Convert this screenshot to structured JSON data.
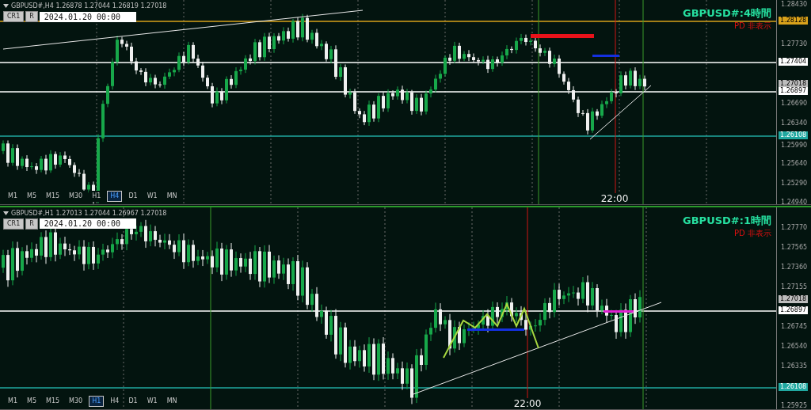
{
  "panels": [
    {
      "symbol_line": "GBPUSD#,H4  1.26878 1.27044 1.26819 1.27018",
      "buttons": [
        "CR1",
        "R"
      ],
      "date_field": "2024.01.20 00:00",
      "title": "GBPUSD#:4時間",
      "status": "PD 非表示",
      "axis_ticks": [
        "1.28430",
        "1.27730",
        "1.26690",
        "1.26340",
        "1.25990",
        "1.25640",
        "1.25290",
        "1.24940"
      ],
      "price_labels": [
        {
          "text": "1.28128",
          "color": "#d9a21b",
          "line": true
        },
        {
          "text": "1.27404",
          "color": "#ffffff",
          "line": true
        },
        {
          "text": "1.27018",
          "color": "#bdbdbd",
          "line": false
        },
        {
          "text": "1.26897",
          "color": "#ffffff",
          "line": true
        },
        {
          "text": "1.26108",
          "color": "#20a8a0",
          "line": true
        }
      ],
      "time_label": "22:00",
      "timeframes": [
        {
          "label": "M1",
          "selected": false
        },
        {
          "label": "M5",
          "selected": false
        },
        {
          "label": "M15",
          "selected": false
        },
        {
          "label": "M30",
          "selected": false
        },
        {
          "label": "H1",
          "selected": false
        },
        {
          "label": "H4",
          "selected": true
        },
        {
          "label": "D1",
          "selected": false
        },
        {
          "label": "W1",
          "selected": false
        },
        {
          "label": "MN",
          "selected": false
        }
      ]
    },
    {
      "symbol_line": "GBPUSD#,H1  1.27013 1.27044 1.26967 1.27018",
      "buttons": [
        "CR1",
        "R"
      ],
      "date_field": "2024.01.20 00:00",
      "title": "GBPUSD#:1時間",
      "status": "PD 非表示",
      "axis_ticks": [
        "1.27770",
        "1.27565",
        "1.27360",
        "1.27155",
        "1.26745",
        "1.26540",
        "1.26335",
        "1.25925"
      ],
      "price_labels": [
        {
          "text": "1.27018",
          "color": "#bdbdbd",
          "line": false
        },
        {
          "text": "1.26897",
          "color": "#ffffff",
          "line": true
        },
        {
          "text": "1.26108",
          "color": "#20a8a0",
          "line": true
        }
      ],
      "time_label": "22:00",
      "timeframes": [
        {
          "label": "M1",
          "selected": false
        },
        {
          "label": "M5",
          "selected": false
        },
        {
          "label": "M15",
          "selected": false
        },
        {
          "label": "M30",
          "selected": false
        },
        {
          "label": "H1",
          "selected": true
        },
        {
          "label": "H4",
          "selected": false
        },
        {
          "label": "D1",
          "selected": false
        },
        {
          "label": "W1",
          "selected": false
        },
        {
          "label": "MN",
          "selected": false
        }
      ]
    }
  ]
}
